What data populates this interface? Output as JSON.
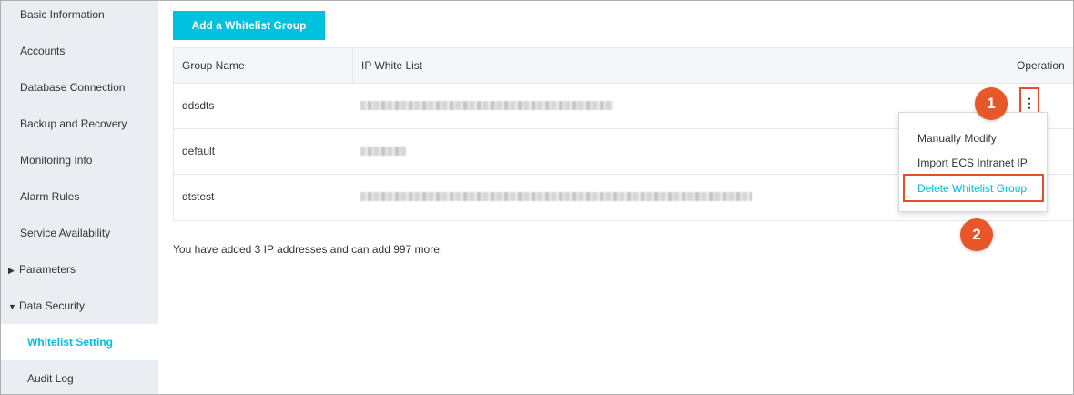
{
  "sidebar": {
    "items": [
      {
        "label": "Basic Information"
      },
      {
        "label": "Accounts"
      },
      {
        "label": "Database Connection"
      },
      {
        "label": "Backup and Recovery"
      },
      {
        "label": "Monitoring Info"
      },
      {
        "label": "Alarm Rules"
      },
      {
        "label": "Service Availability"
      },
      {
        "label": "Parameters",
        "expanded": false
      },
      {
        "label": "Data Security",
        "expanded": true
      },
      {
        "label": "Whitelist Setting",
        "active": true
      },
      {
        "label": "Audit Log"
      }
    ]
  },
  "main": {
    "add_button_label": "Add a Whitelist Group",
    "table": {
      "headers": [
        "Group Name",
        "IP White List",
        "Operation"
      ],
      "rows": [
        {
          "group_name": "ddsdts"
        },
        {
          "group_name": "default"
        },
        {
          "group_name": "dtstest"
        }
      ]
    },
    "footnote": "You have added 3 IP addresses and can add 997 more."
  },
  "more_button": {
    "glyph": "⋮"
  },
  "dropdown": {
    "items": [
      "Manually Modify",
      "Import ECS Intranet IP",
      "Delete Whitelist Group"
    ]
  },
  "callouts": {
    "step1": "1",
    "step2": "2",
    "color": "#e8572a"
  },
  "colors": {
    "accent": "#00c1de",
    "highlight": "#e74c2b",
    "sidebar_bg": "#eaedf1"
  }
}
